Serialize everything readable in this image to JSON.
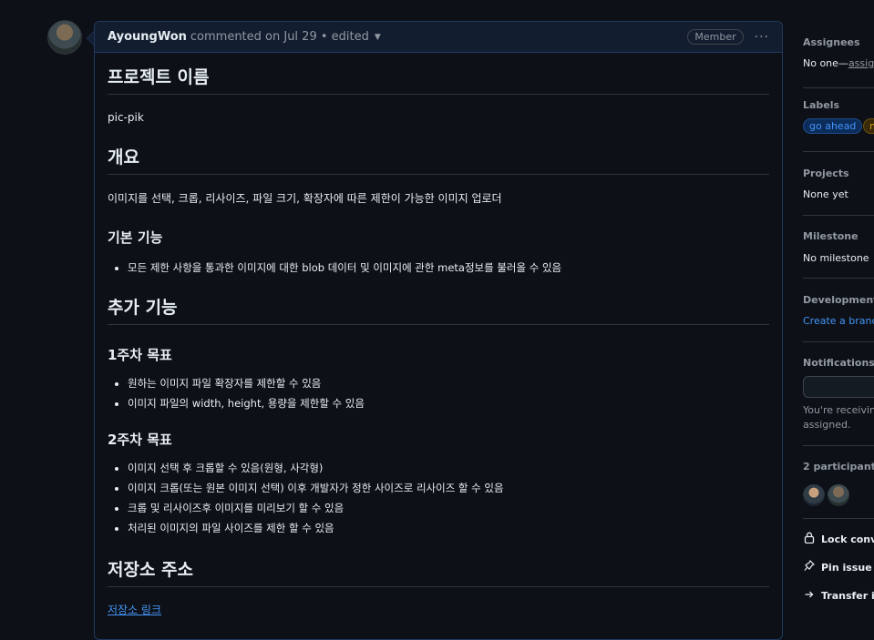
{
  "comment": {
    "author": "AyoungWon",
    "meta": "commented on Jul 29 • edited",
    "badge": "Member",
    "more": "···"
  },
  "content": {
    "h_project": "프로젝트 이름",
    "project_name": "pic-pik",
    "h_overview": "개요",
    "overview": "이미지를 선택, 크롭, 리사이즈, 파일 크기, 확장자에 따른 제한이 가능한 이미지 업로더",
    "h_basic": "기본 기능",
    "basic_items": [
      "모든 제한 사항을 통과한 이미지에 대한 blob 데이터 및 이미지에 관한 meta정보를 불러올 수 있음"
    ],
    "h_extra": "추가 기능",
    "h_week1": "1주차 목표",
    "week1_items": [
      "원하는 이미지 파일 확장자를 제한할 수 있음",
      "이미지 파일의 width, height, 용량을 제한할 수 있음"
    ],
    "h_week2": "2주차 목표",
    "week2_items": [
      "이미지 선택 후 크롭할 수 있음(원형, 사각형)",
      "이미지 크롭(또는 원본 이미지 선택) 이후 개발자가 정한 사이즈로 리사이즈 할 수 있음",
      "크롭 및 리사이즈후 이미지를 미리보기 할 수 있음",
      "처리된 이미지의 파일 사이즈를 제한 할 수 있음"
    ],
    "h_repo": "저장소 주소",
    "repo_link": "저장소 링크"
  },
  "sidebar": {
    "assignees_title": "Assignees",
    "assignees_value": "No one—",
    "assignees_link": "assign",
    "labels_title": "Labels",
    "labels": [
      {
        "text": "go ahead",
        "color": "#4493f8"
      },
      {
        "text": "m",
        "color": "#d29922"
      }
    ],
    "projects_title": "Projects",
    "projects_value": "None yet",
    "milestone_title": "Milestone",
    "milestone_value": "No milestone",
    "development_title": "Development",
    "development_link": "Create a branch",
    "notifications_title": "Notifications",
    "notifications_line1": "You're receiving",
    "notifications_line2": "assigned.",
    "participants_title": "2 participants",
    "lock": "Lock conve",
    "pin": "Pin issue",
    "transfer": "Transfer iss"
  }
}
